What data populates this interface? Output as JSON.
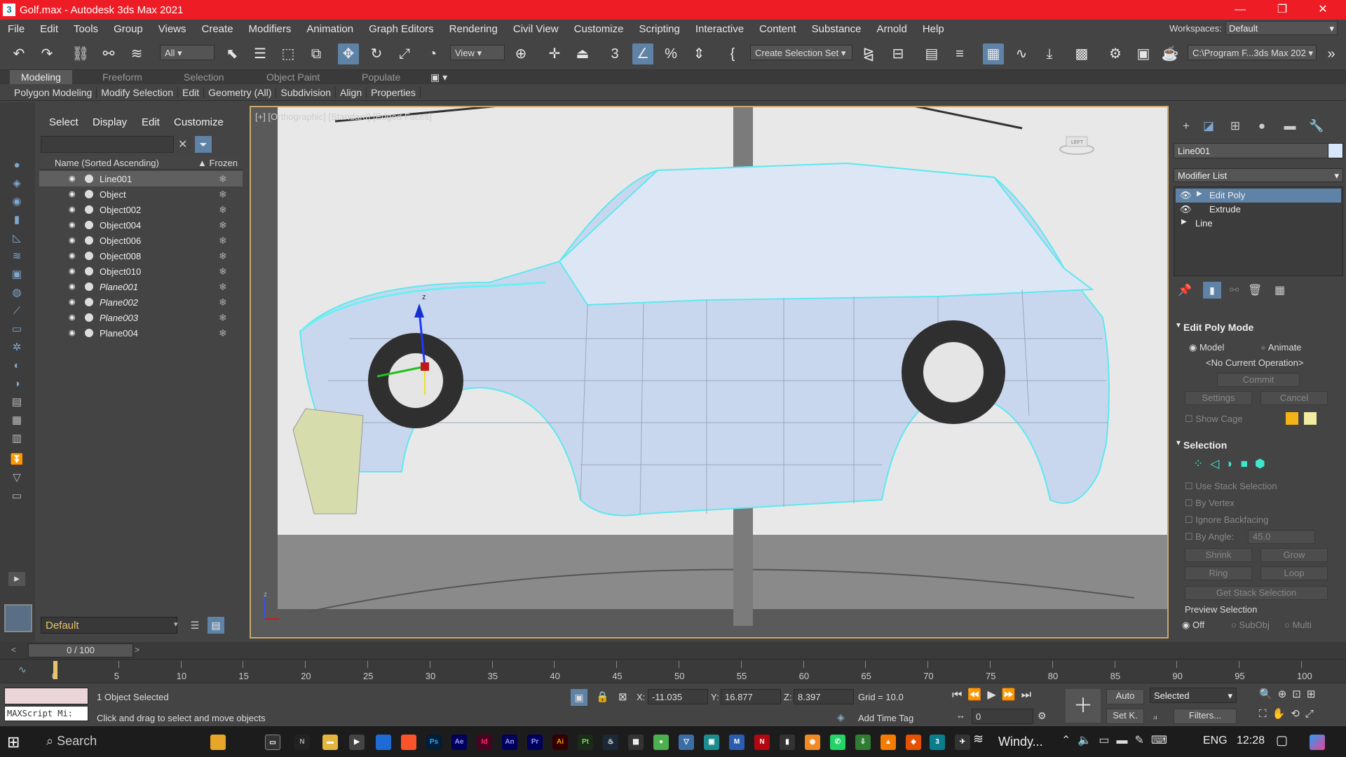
{
  "app": {
    "title": "Golf.max - Autodesk 3ds Max 2021",
    "logo": "3"
  },
  "menu": [
    "File",
    "Edit",
    "Tools",
    "Group",
    "Views",
    "Create",
    "Modifiers",
    "Animation",
    "Graph Editors",
    "Rendering",
    "Civil View",
    "Customize",
    "Scripting",
    "Interactive",
    "Content",
    "Substance",
    "Arnold",
    "Help"
  ],
  "workspace": {
    "label": "Workspaces:",
    "value": "Default"
  },
  "toolbar": {
    "filter": "All",
    "refcoord": "View",
    "selset": "Create Selection Set",
    "path": "C:\\Program F...3ds Max 202"
  },
  "ribbon": {
    "tabs": [
      "Modeling",
      "Freeform",
      "Selection",
      "Object Paint",
      "Populate"
    ],
    "groups": [
      "Polygon Modeling",
      "Modify Selection",
      "Edit",
      "Geometry (All)",
      "Subdivision",
      "Align",
      "Properties"
    ]
  },
  "scene": {
    "menu": [
      "Select",
      "Display",
      "Edit",
      "Customize"
    ],
    "col_name": "Name (Sorted Ascending)",
    "col_frozen": "▲ Frozen",
    "rows": [
      {
        "name": "Line001",
        "italic": false,
        "selected": true
      },
      {
        "name": "Object",
        "italic": false,
        "selected": false
      },
      {
        "name": "Object002",
        "italic": false,
        "selected": false
      },
      {
        "name": "Object004",
        "italic": false,
        "selected": false
      },
      {
        "name": "Object006",
        "italic": false,
        "selected": false
      },
      {
        "name": "Object008",
        "italic": false,
        "selected": false
      },
      {
        "name": "Object010",
        "italic": false,
        "selected": false
      },
      {
        "name": "Plane001",
        "italic": true,
        "selected": false
      },
      {
        "name": "Plane002",
        "italic": true,
        "selected": false
      },
      {
        "name": "Plane003",
        "italic": true,
        "selected": false
      },
      {
        "name": "Plane004",
        "italic": false,
        "selected": false
      }
    ],
    "layer": "Default"
  },
  "viewport": {
    "label": "[+] [Orthographic] [Standard] [Edged Faces]",
    "viewcube": "LEFT",
    "axis_x": "x",
    "axis_z": "z"
  },
  "cmd": {
    "obj_name": "Line001",
    "modlist": "Modifier List",
    "stack": [
      "Edit Poly",
      "Extrude",
      "Line"
    ],
    "epm": {
      "title": "Edit Poly Mode",
      "model": "Model",
      "animate": "Animate",
      "noop": "<No Current Operation>",
      "commit": "Commit",
      "settings": "Settings",
      "cancel": "Cancel",
      "showcage": "Show Cage"
    },
    "sel": {
      "title": "Selection",
      "use_stack": "Use Stack Selection",
      "by_vertex": "By Vertex",
      "ignore_bf": "Ignore Backfacing",
      "by_angle": "By Angle:",
      "angle": "45.0",
      "shrink": "Shrink",
      "grow": "Grow",
      "ring": "Ring",
      "loop": "Loop",
      "get_stack": "Get Stack Selection",
      "preview": "Preview Selection",
      "off": "Off",
      "subobj": "SubObj",
      "multi": "Multi"
    }
  },
  "time": {
    "slider": "0 / 100",
    "ticks": [
      "0",
      "5",
      "10",
      "15",
      "20",
      "25",
      "30",
      "35",
      "40",
      "45",
      "50",
      "55",
      "60",
      "65",
      "70",
      "75",
      "80",
      "85",
      "90",
      "95",
      "100"
    ]
  },
  "status": {
    "maxscript": "MAXScript Mi:",
    "selected": "1 Object Selected",
    "prompt": "Click and drag to select and move objects",
    "x": "-11.035",
    "y": "16.877",
    "z": "8.397",
    "grid": "Grid = 10.0",
    "add_time_tag": "Add Time Tag",
    "auto": "Auto",
    "setk": "Set K.",
    "selmode": "Selected",
    "filters": "Filters...",
    "frame": "0",
    "xl": "X:",
    "yl": "Y:",
    "zl": "Z:"
  },
  "taskbar": {
    "search": "Search",
    "windy": "Windy...",
    "lang": "ENG",
    "time": "12:28"
  },
  "colors": {
    "title": "#ee1c25",
    "accent": "#5f82a7",
    "car": "#c9d7ee",
    "edge": "#5ee8ee",
    "layer": "#e8c56c"
  }
}
